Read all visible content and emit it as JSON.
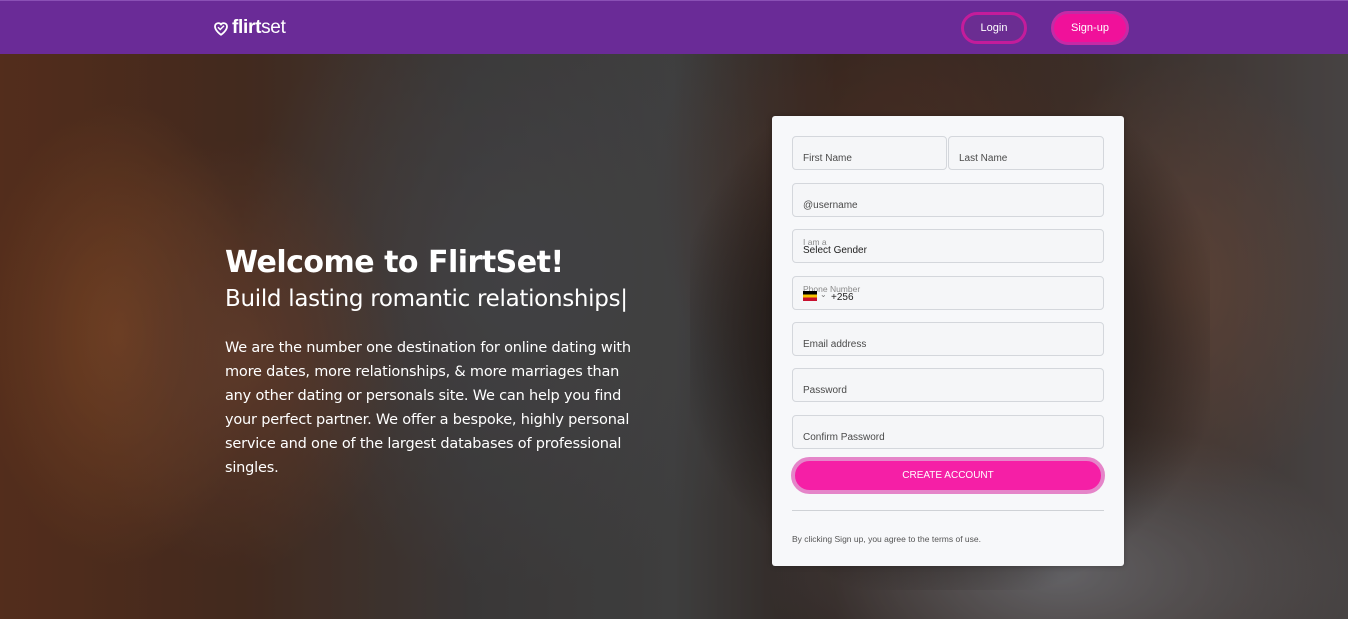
{
  "navbar": {
    "logo_bold": "flirt",
    "logo_rest": "set",
    "logo_icon": "heart-icon",
    "login_label": "Login",
    "signup_label": "Sign-up",
    "bg_color": "#6a2b97",
    "accent_color": "#f0119a"
  },
  "hero": {
    "title": "Welcome to FlirtSet!",
    "subtitle": "Build lasting romantic relationships",
    "cursor": "|",
    "description": "We are the number one destination for online dating with more dates, more relationships, & more marriages than any other dating or personals site. We can help you find your perfect partner. We offer a bespoke, highly personal service and one of the largest databases of professional singles."
  },
  "form": {
    "first_name_placeholder": "First Name",
    "last_name_placeholder": "Last Name",
    "username_placeholder": "@username",
    "gender_label": "I am a",
    "gender_value": "Select Gender",
    "phone_label": "Phone Number",
    "phone_code": "+256",
    "flag_icon": "uganda-flag-icon",
    "email_placeholder": "Email address",
    "password_placeholder": "Password",
    "confirm_password_placeholder": "Confirm Password",
    "submit_label": "CREATE ACCOUNT",
    "terms_text": "By clicking Sign up, you agree to the terms of use."
  }
}
